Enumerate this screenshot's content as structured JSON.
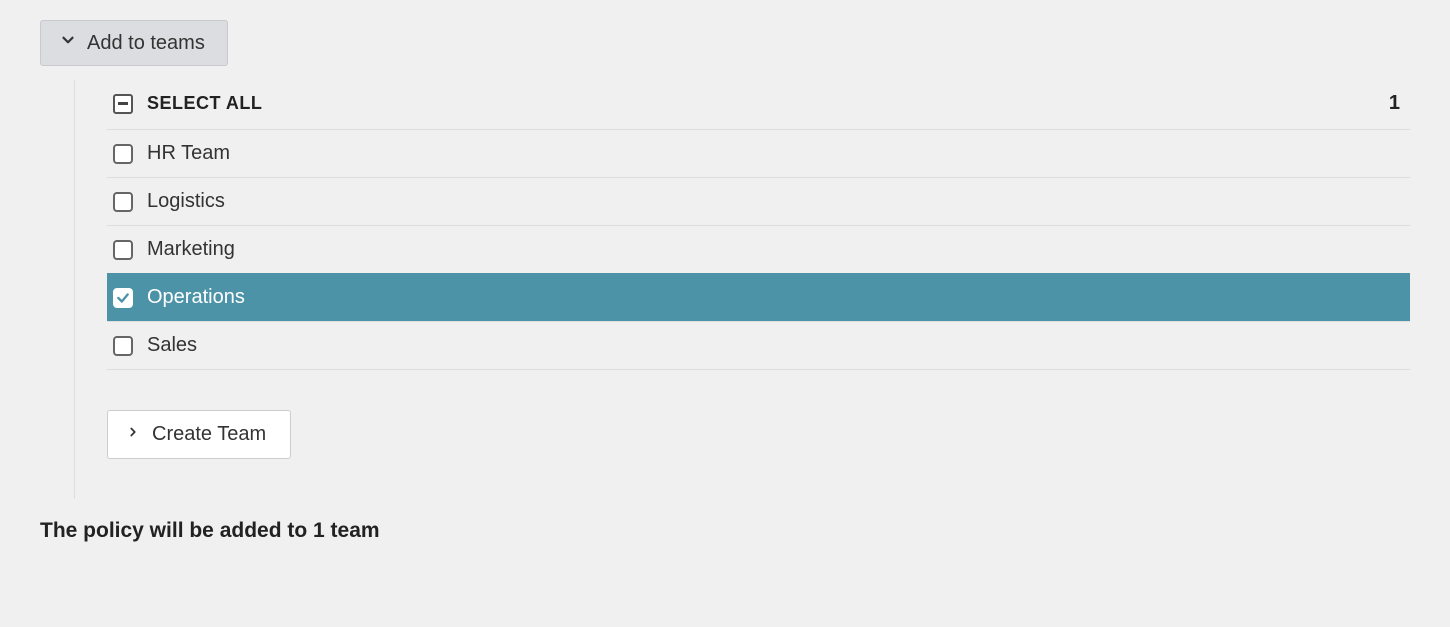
{
  "header": {
    "toggle_label": "Add to teams"
  },
  "select_all": {
    "label": "SELECT ALL",
    "state": "indeterminate",
    "selected_count": "1"
  },
  "teams": [
    {
      "name": "HR Team",
      "checked": false
    },
    {
      "name": "Logistics",
      "checked": false
    },
    {
      "name": "Marketing",
      "checked": false
    },
    {
      "name": "Operations",
      "checked": true
    },
    {
      "name": "Sales",
      "checked": false
    }
  ],
  "create_team": {
    "label": "Create Team"
  },
  "summary_text": "The policy will be added to 1 team"
}
